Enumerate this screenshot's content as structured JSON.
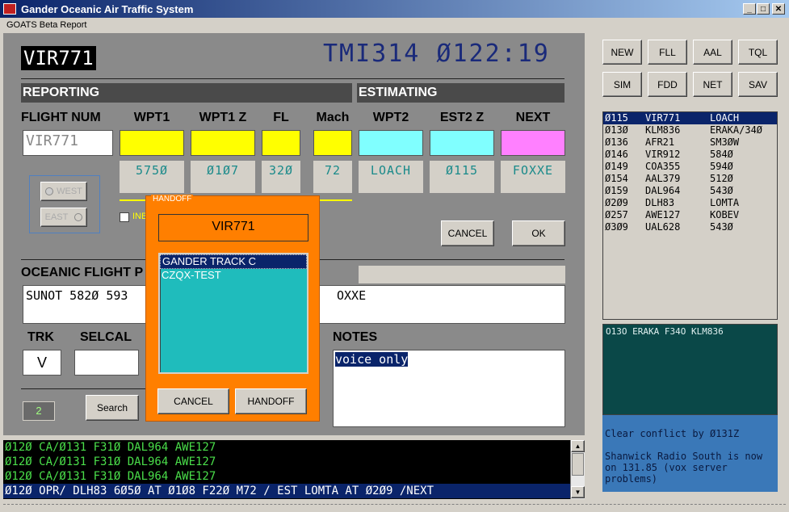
{
  "window": {
    "title": "Gander Oceanic Air Traffic System",
    "min": "_",
    "max": "□",
    "close": "✕"
  },
  "menu": {
    "item1": "GOATS Beta Report"
  },
  "header": {
    "callsign": "VIR771",
    "clock": "TMI314 Ø122:19"
  },
  "sections": {
    "reporting": "REPORTING",
    "estimating": "ESTIMATING",
    "route": "OCEANIC FLIGHT P",
    "notes": "NOTES"
  },
  "columns": {
    "flight_num": "FLIGHT NUM",
    "wpt1": "WPT1",
    "wpt1z": "WPT1 Z",
    "fl": "FL",
    "mach": "Mach",
    "wpt2": "WPT2",
    "est2z": "EST2 Z",
    "next": "NEXT",
    "trk": "TRK",
    "selcal": "SELCAL"
  },
  "fields": {
    "flight_num": "VIR771",
    "wpt1": "575Ø",
    "wpt1z": "Ø1Ø7",
    "fl": "32Ø",
    "mach": "72",
    "wpt2": "LOACH",
    "est2z": "Ø115",
    "next": "FOXXE",
    "route_left": "SUNOT 582Ø 593",
    "route_right": "OXXE",
    "trk": "V",
    "selcal": "",
    "notes": "voice only",
    "counter": "2"
  },
  "direction": {
    "west": "WEST",
    "east": "EAST",
    "inbound_label": "INB"
  },
  "buttons": {
    "cancel": "CANCEL",
    "ok": "OK",
    "search": "Search"
  },
  "toolbar": {
    "row1": [
      "NEW",
      "FLL",
      "AAL",
      "TQL"
    ],
    "row2": [
      "SIM",
      "FDD",
      "NET",
      "SAV"
    ]
  },
  "flight_list": [
    {
      "time": "Ø115",
      "callsign": "VIR771",
      "fix": "LOACH",
      "selected": true
    },
    {
      "time": "Ø13Ø",
      "callsign": "KLM836",
      "fix": "ERAKA/34Ø",
      "selected": false
    },
    {
      "time": "Ø136",
      "callsign": "AFR21",
      "fix": "SM3ØW",
      "selected": false
    },
    {
      "time": "Ø146",
      "callsign": "VIR912",
      "fix": "584Ø",
      "selected": false
    },
    {
      "time": "Ø149",
      "callsign": "COA355",
      "fix": "594Ø",
      "selected": false
    },
    {
      "time": "Ø154",
      "callsign": "AAL379",
      "fix": "512Ø",
      "selected": false
    },
    {
      "time": "Ø159",
      "callsign": "DAL964",
      "fix": "543Ø",
      "selected": false
    },
    {
      "time": "Ø2Ø9",
      "callsign": "DLH83",
      "fix": "LOMTA",
      "selected": false
    },
    {
      "time": "Ø257",
      "callsign": "AWE127",
      "fix": "KOBEV",
      "selected": false
    },
    {
      "time": "Ø3Ø9",
      "callsign": "UAL628",
      "fix": "543Ø",
      "selected": false
    }
  ],
  "conflict": {
    "text": "O13O ERAKA F34O KLM836"
  },
  "messages": {
    "text": "Clear conflict by Ø131Z\n\nShanwick Radio South is now on 131.85 (vox server problems)"
  },
  "console_lines": [
    "Ø12Ø CA/Ø131 F31Ø DAL964 AWE127",
    "Ø12Ø CA/Ø131 F31Ø DAL964 AWE127",
    "Ø12Ø CA/Ø131 F31Ø DAL964 AWE127",
    "Ø12Ø OPR/ DLH83 6Ø5Ø AT Ø1Ø8 F22Ø M72 / EST LOMTA AT Ø2Ø9 /NEXT"
  ],
  "handoff": {
    "title": "HANDOFF",
    "callsign": "VIR771",
    "options": [
      {
        "label": "GANDER TRACK C",
        "selected": true
      },
      {
        "label": "CZQX-TEST",
        "selected": false
      }
    ],
    "cancel": "CANCEL",
    "confirm": "HANDOFF"
  },
  "colors": {
    "titlebar": "#0a246a",
    "panel": "#8a8a8a",
    "yellow": "#ffff00",
    "cyan": "#80ffff",
    "magenta": "#ff80ff",
    "orange": "#ff7f00",
    "teal": "#1fbcbc",
    "dark_teal": "#0a4848",
    "msg_blue": "#3a78b8"
  }
}
